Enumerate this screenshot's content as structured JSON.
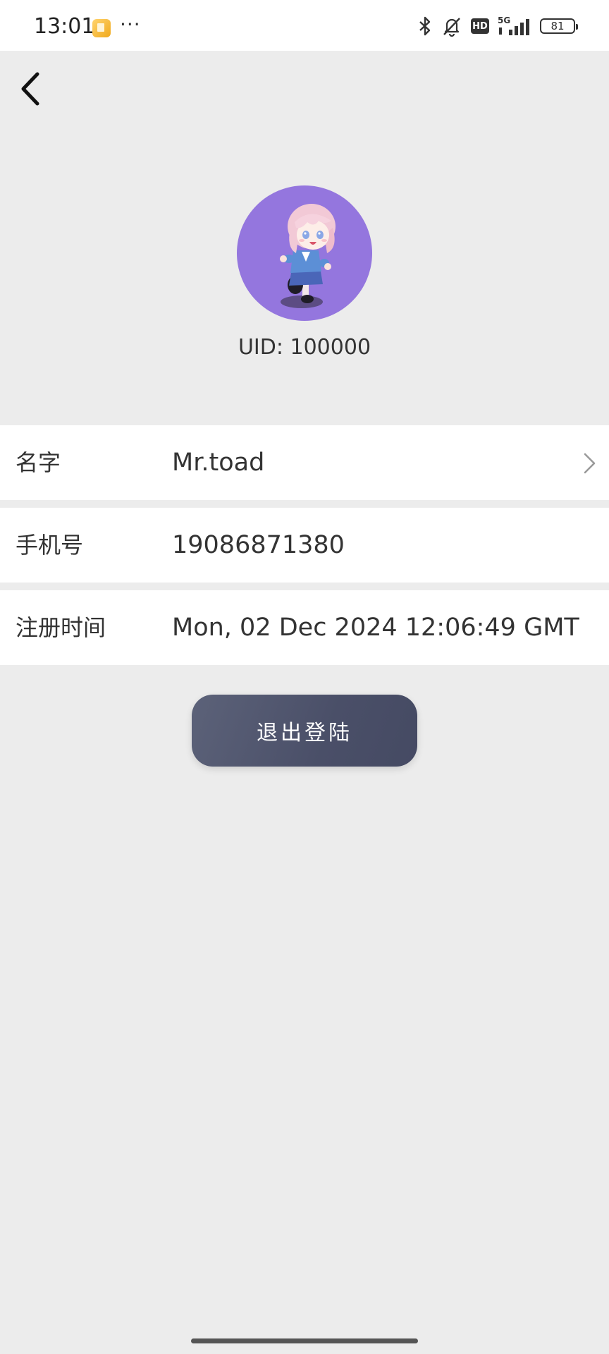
{
  "status_bar": {
    "time": "13:01",
    "more": "···",
    "network": "5G",
    "hd": "HD",
    "battery": "81"
  },
  "profile": {
    "uid_text": "UID: 100000"
  },
  "rows": {
    "name": {
      "label": "名字",
      "value": "Mr.toad"
    },
    "phone": {
      "label": "手机号",
      "value": "19086871380"
    },
    "registered": {
      "label": "注册时间",
      "value": "Mon, 02 Dec 2024 12:06:49 GMT"
    }
  },
  "logout": {
    "label": "退出登陆"
  },
  "colors": {
    "background": "#ececec",
    "avatar_bg": "#9476de",
    "button": "#4f546c"
  },
  "icons": {
    "back": "chevron-left-icon",
    "row_arrow": "chevron-right-icon"
  }
}
